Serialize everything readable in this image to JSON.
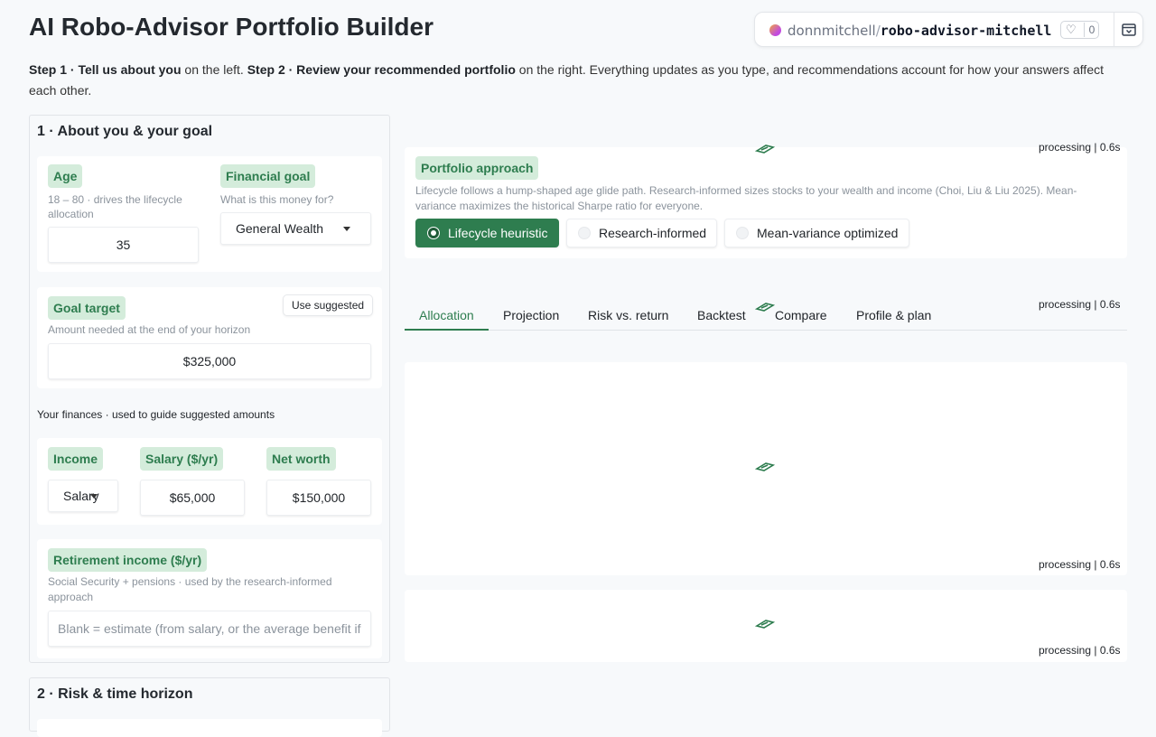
{
  "page": {
    "title": "AI Robo-Advisor Portfolio Builder",
    "intro": {
      "step1_bold": "Step 1 · Tell us about you",
      "step1_rest": " on the left. ",
      "step2_bold": "Step 2 · Review your recommended portfolio",
      "step2_rest": " on the right. Everything updates as you type, and recommendations account for how your answers affect each other."
    }
  },
  "hf": {
    "user": "donnmitchell",
    "separator": "/",
    "repo": "robo-advisor-mitchell",
    "likes": "0"
  },
  "section1": {
    "title": "1 · About you & your goal",
    "age": {
      "label": "Age",
      "hint": "18 – 80 · drives the lifecycle allocation",
      "value": "35"
    },
    "goal": {
      "label": "Financial goal",
      "hint": "What is this money for?",
      "value": "General Wealth"
    },
    "target": {
      "label": "Goal target",
      "hint": "Amount needed at the end of your horizon",
      "value": "$325,000",
      "suggest_button": "Use suggested"
    },
    "finances_note": "Your finances · used to guide suggested amounts",
    "income": {
      "label": "Income",
      "value": "Salary"
    },
    "salary": {
      "label": "Salary ($/yr)",
      "value": "$65,000"
    },
    "networth": {
      "label": "Net worth",
      "value": "$150,000"
    },
    "retirement": {
      "label": "Retirement income ($/yr)",
      "hint": "Social Security + pensions · used by the research-informed approach",
      "placeholder": "Blank = estimate (from salary, or the average benefit if"
    }
  },
  "section2": {
    "title": "2 · Risk & time horizon"
  },
  "approach": {
    "label": "Portfolio approach",
    "hint": "Lifecycle follows a hump-shaped age glide path. Research-informed sizes stocks to your wealth and income (Choi, Liu & Liu 2025). Mean-variance maximizes the historical Sharpe ratio for everyone.",
    "options": [
      "Lifecycle heuristic",
      "Research-informed",
      "Mean-variance optimized"
    ],
    "selected": "Lifecycle heuristic"
  },
  "status": {
    "processing": "processing | 0.6s"
  },
  "tabs": [
    "Allocation",
    "Projection",
    "Risk vs. return",
    "Backtest",
    "Compare",
    "Profile & plan"
  ],
  "active_tab": "Allocation",
  "colors": {
    "accent": "#2e7d4f",
    "tag_bg": "#d4ecdb"
  }
}
